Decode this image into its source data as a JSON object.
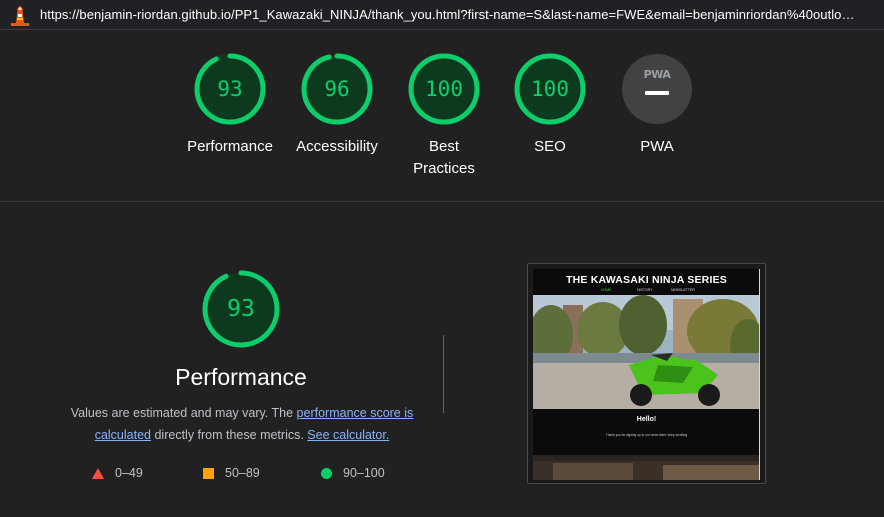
{
  "address_bar": {
    "url": "https://benjamin-riordan.github.io/PP1_Kawazaki_NINJA/thank_you.html?first-name=S&last-name=FWE&email=benjaminriordan%40outlo…"
  },
  "category_gauges": [
    {
      "score": "93",
      "label": "Performance"
    },
    {
      "score": "96",
      "label": "Accessibility"
    },
    {
      "score": "100",
      "label": "Best Practices"
    },
    {
      "score": "100",
      "label": "SEO"
    },
    {
      "score": "PWA",
      "label": "PWA"
    }
  ],
  "performance": {
    "score": "93",
    "title": "Performance",
    "desc_before": "Values are estimated and may vary. The ",
    "link_score": "performance score is calculated",
    "desc_middle": " directly from these metrics. ",
    "link_calculator": "See calculator.",
    "legend": [
      {
        "range": "0–49",
        "color": "#ff4e42",
        "shape": "triangle"
      },
      {
        "range": "50–89",
        "color": "#ffa400",
        "shape": "square"
      },
      {
        "range": "90–100",
        "color": "#0cce6b",
        "shape": "circle"
      }
    ]
  },
  "screenshot": {
    "site_title": "THE KAWASAKI NINJA SERIES",
    "nav": [
      "HOME",
      "HISTORY",
      "NEWSLETTER"
    ],
    "heading": "Hello!",
    "message": "Thank you for signing up to our news letter. keep scrolling"
  },
  "colors": {
    "pass": "#0cce6b",
    "pass_fill": "#0d3a1f",
    "neutral_gauge": "#424242",
    "link": "#8ab4f8"
  }
}
